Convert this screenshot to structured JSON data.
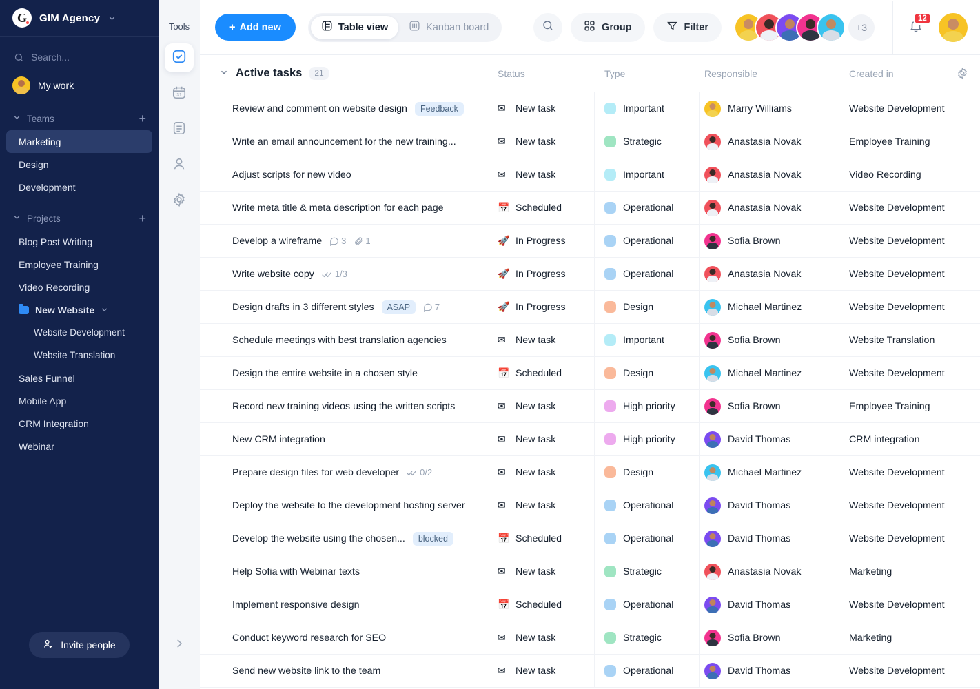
{
  "sidebar": {
    "brand": {
      "logo_letter": "G",
      "name": "GIM Agency",
      "caret_icon": "chevron-down-icon"
    },
    "search_placeholder": "Search...",
    "my_work": "My work",
    "teams_label": "Teams",
    "teams_add": "+",
    "teams": [
      {
        "label": "Marketing",
        "active": true
      },
      {
        "label": "Design",
        "active": false
      },
      {
        "label": "Development",
        "active": false
      }
    ],
    "projects_label": "Projects",
    "projects_add": "+",
    "projects": [
      {
        "label": "Blog Post Writing",
        "type": "item"
      },
      {
        "label": "Employee Training",
        "type": "item"
      },
      {
        "label": "Video Recording",
        "type": "item"
      },
      {
        "label": "New Website",
        "type": "folder"
      },
      {
        "label": "Website Development",
        "type": "sub"
      },
      {
        "label": "Website Translation",
        "type": "sub"
      },
      {
        "label": "Sales Funnel",
        "type": "item"
      },
      {
        "label": "Mobile App",
        "type": "item"
      },
      {
        "label": "CRM Integration",
        "type": "item"
      },
      {
        "label": "Webinar",
        "type": "item"
      }
    ],
    "invite_label": "Invite people"
  },
  "tools": {
    "title": "Tools",
    "items": [
      {
        "icon": "tasks-check-icon",
        "active": true
      },
      {
        "icon": "calendar-icon",
        "active": false
      },
      {
        "icon": "document-icon",
        "active": false
      },
      {
        "icon": "person-icon",
        "active": false
      },
      {
        "icon": "gear-icon",
        "active": false
      }
    ],
    "expand_icon": "chevron-right-icon"
  },
  "topbar": {
    "add_new": "Add new",
    "views": [
      {
        "label": "Table view",
        "icon": "table-icon",
        "active": true
      },
      {
        "label": "Kanban board",
        "icon": "kanban-icon",
        "active": false
      }
    ],
    "search_icon": "search-icon",
    "group_label": "Group",
    "filter_label": "Filter",
    "avatars": [
      "#f7c325",
      "#f0515b",
      "#7b4bf0",
      "#f2338f",
      "#39c3ef"
    ],
    "more_members": "+3",
    "notifications_count": "12",
    "user_avatar_color": "#f7c325"
  },
  "table": {
    "group_title": "Active tasks",
    "group_count": "21",
    "settings_icon": "gear-icon",
    "columns": [
      "",
      "Status",
      "Type",
      "Responsible",
      "Created in"
    ],
    "type_colors": {
      "Important": "#b4ecf7",
      "Strategic": "#9fe5c2",
      "Operational": "#a9d3f5",
      "Design": "#fab99a",
      "High priority": "#edaaee"
    },
    "status_icons": {
      "New task": "✉",
      "Scheduled": "📅",
      "In Progress": "🚀"
    },
    "avatar_colors": {
      "Marry Williams": "#f7c325",
      "Anastasia Novak": "#f0515b",
      "Sofia Brown": "#f2338f",
      "Michael Martinez": "#39c3ef",
      "David Thomas": "#7b4bf0"
    },
    "rows": [
      {
        "task": "Review and comment on website design",
        "tag": "Feedback",
        "status": "New task",
        "type": "Important",
        "responsible": "Marry Williams",
        "created_in": "Website Development"
      },
      {
        "task": "Write an email announcement for the new training...",
        "status": "New task",
        "type": "Strategic",
        "responsible": "Anastasia Novak",
        "created_in": "Employee Training"
      },
      {
        "task": "Adjust scripts for new video",
        "status": "New task",
        "type": "Important",
        "responsible": "Anastasia Novak",
        "created_in": "Video Recording"
      },
      {
        "task": "Write meta title & meta description for each page",
        "status": "Scheduled",
        "type": "Operational",
        "responsible": "Anastasia Novak",
        "created_in": "Website Development"
      },
      {
        "task": "Develop a wireframe",
        "comments": "3",
        "attachments": "1",
        "status": "In Progress",
        "type": "Operational",
        "responsible": "Sofia Brown",
        "created_in": "Website Development"
      },
      {
        "task": "Write website copy",
        "checklist": "1/3",
        "status": "In Progress",
        "type": "Operational",
        "responsible": "Anastasia Novak",
        "created_in": "Website Development"
      },
      {
        "task": "Design drafts in 3 different styles",
        "tag": "ASAP",
        "comments": "7",
        "status": "In Progress",
        "type": "Design",
        "responsible": "Michael Martinez",
        "created_in": "Website Development"
      },
      {
        "task": "Schedule meetings with best translation agencies",
        "status": "New task",
        "type": "Important",
        "responsible": "Sofia Brown",
        "created_in": "Website Translation"
      },
      {
        "task": "Design the entire website in a chosen style",
        "status": "Scheduled",
        "type": "Design",
        "responsible": "Michael Martinez",
        "created_in": "Website Development"
      },
      {
        "task": "Record new training videos using the written scripts",
        "status": "New task",
        "type": "High priority",
        "responsible": "Sofia Brown",
        "created_in": "Employee Training"
      },
      {
        "task": "New CRM integration",
        "status": "New task",
        "type": "High priority",
        "responsible": "David Thomas",
        "created_in": "CRM integration"
      },
      {
        "task": "Prepare design files for web developer",
        "checklist": "0/2",
        "status": "New task",
        "type": "Design",
        "responsible": "Michael Martinez",
        "created_in": "Website Development"
      },
      {
        "task": "Deploy the website to the development hosting server",
        "status": "New task",
        "type": "Operational",
        "responsible": "David Thomas",
        "created_in": "Website Development"
      },
      {
        "task": "Develop the website using the chosen...",
        "tag": "blocked",
        "status": "Scheduled",
        "type": "Operational",
        "responsible": "David Thomas",
        "created_in": "Website Development"
      },
      {
        "task": "Help Sofia with Webinar texts",
        "status": "New task",
        "type": "Strategic",
        "responsible": "Anastasia Novak",
        "created_in": "Marketing"
      },
      {
        "task": "Implement responsive design",
        "status": "Scheduled",
        "type": "Operational",
        "responsible": "David Thomas",
        "created_in": "Website Development"
      },
      {
        "task": "Conduct keyword research for SEO",
        "status": "New task",
        "type": "Strategic",
        "responsible": "Sofia Brown",
        "created_in": "Marketing"
      },
      {
        "task": "Send new website link to the team",
        "status": "New task",
        "type": "Operational",
        "responsible": "David Thomas",
        "created_in": "Website Development"
      }
    ]
  }
}
